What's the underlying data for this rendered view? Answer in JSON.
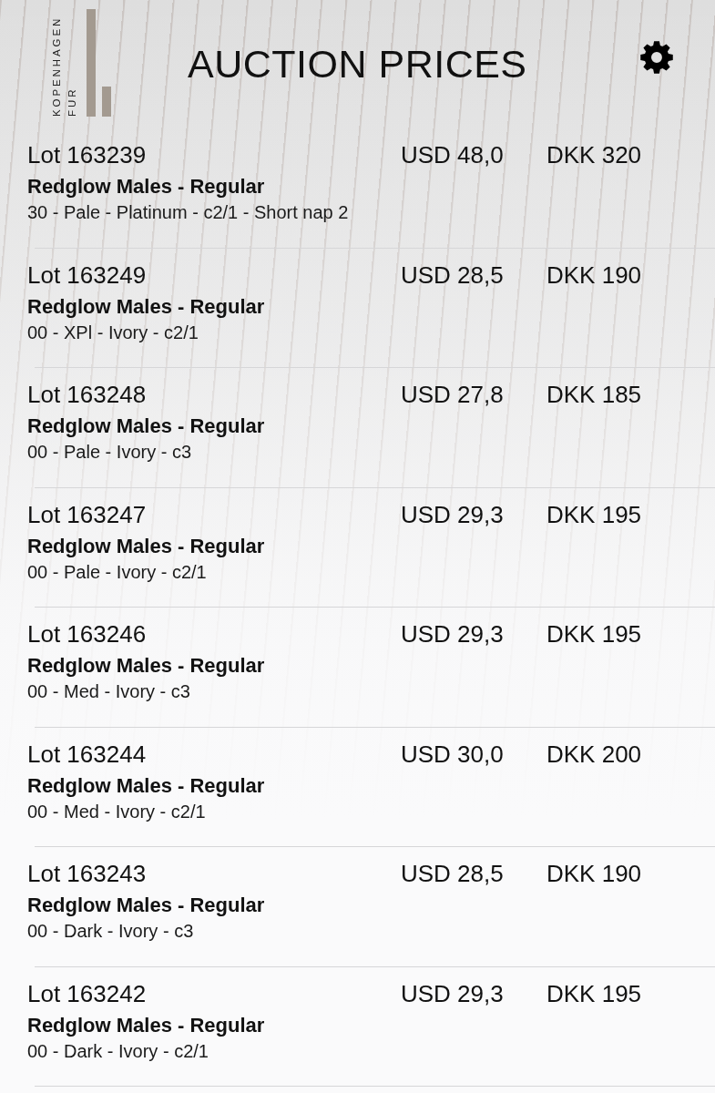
{
  "header": {
    "logo": {
      "lines": [
        "KOPENHAGEN",
        "FUR"
      ]
    },
    "title": "AUCTION PRICES"
  },
  "lots": [
    {
      "lot": "Lot 163239",
      "usd": "USD 48,0",
      "dkk": "DKK 320",
      "type": "Redglow Males - Regular",
      "grade": "30 - Pale - Platinum - c2/1 - Short nap 2"
    },
    {
      "lot": "Lot 163249",
      "usd": "USD 28,5",
      "dkk": "DKK 190",
      "type": "Redglow Males - Regular",
      "grade": "00 - XPl - Ivory - c2/1"
    },
    {
      "lot": "Lot 163248",
      "usd": "USD 27,8",
      "dkk": "DKK 185",
      "type": "Redglow Males - Regular",
      "grade": "00 - Pale - Ivory - c3"
    },
    {
      "lot": "Lot 163247",
      "usd": "USD 29,3",
      "dkk": "DKK 195",
      "type": "Redglow Males - Regular",
      "grade": "00 - Pale - Ivory - c2/1"
    },
    {
      "lot": "Lot 163246",
      "usd": "USD 29,3",
      "dkk": "DKK 195",
      "type": "Redglow Males - Regular",
      "grade": "00 - Med - Ivory - c3"
    },
    {
      "lot": "Lot 163244",
      "usd": "USD 30,0",
      "dkk": "DKK 200",
      "type": "Redglow Males - Regular",
      "grade": "00 - Med - Ivory - c2/1"
    },
    {
      "lot": "Lot 163243",
      "usd": "USD 28,5",
      "dkk": "DKK 190",
      "type": "Redglow Males - Regular",
      "grade": "00 - Dark - Ivory - c3"
    },
    {
      "lot": "Lot 163242",
      "usd": "USD 29,3",
      "dkk": "DKK 195",
      "type": "Redglow Males - Regular",
      "grade": "00 - Dark - Ivory - c2/1"
    }
  ]
}
